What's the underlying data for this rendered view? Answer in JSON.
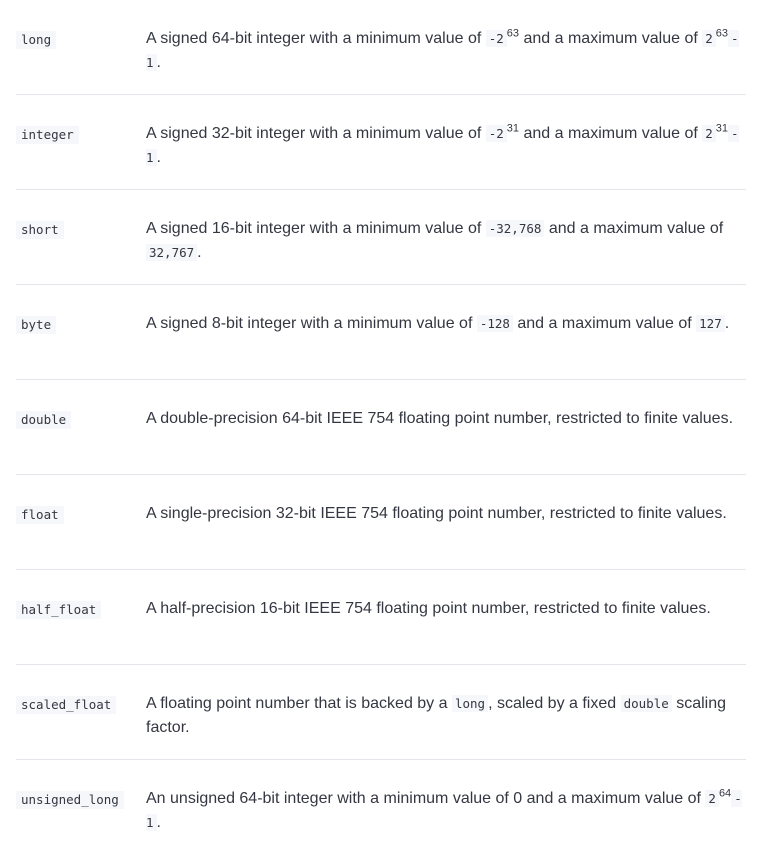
{
  "rows": [
    {
      "type": "long",
      "desc": [
        {
          "t": "A signed 64-bit integer with a minimum value of "
        },
        {
          "code": "-2"
        },
        {
          "sup": "63"
        },
        {
          "t": " and a maximum value of "
        },
        {
          "code": "2"
        },
        {
          "sup": "63"
        },
        {
          "code": "-1"
        },
        {
          "t": "."
        }
      ]
    },
    {
      "type": "integer",
      "desc": [
        {
          "t": "A signed 32-bit integer with a minimum value of "
        },
        {
          "code": "-2"
        },
        {
          "sup": "31"
        },
        {
          "t": " and a maximum value of "
        },
        {
          "code": "2"
        },
        {
          "sup": "31"
        },
        {
          "code": "-1"
        },
        {
          "t": "."
        }
      ]
    },
    {
      "type": "short",
      "desc": [
        {
          "t": "A signed 16-bit integer with a minimum value of "
        },
        {
          "code": "-32,768"
        },
        {
          "t": " and a maximum value of "
        },
        {
          "code": "32,767"
        },
        {
          "t": "."
        }
      ]
    },
    {
      "type": "byte",
      "desc": [
        {
          "t": "A signed 8-bit integer with a minimum value of "
        },
        {
          "code": "-128"
        },
        {
          "t": " and a maximum value of "
        },
        {
          "code": "127"
        },
        {
          "t": "."
        }
      ]
    },
    {
      "type": "double",
      "desc": [
        {
          "t": "A double-precision 64-bit IEEE 754 floating point number, restricted to finite values."
        }
      ]
    },
    {
      "type": "float",
      "desc": [
        {
          "t": "A single-precision 32-bit IEEE 754 floating point number, restricted to finite values."
        }
      ]
    },
    {
      "type": "half_float",
      "desc": [
        {
          "t": "A half-precision 16-bit IEEE 754 floating point number, restricted to finite values."
        }
      ]
    },
    {
      "type": "scaled_float",
      "desc": [
        {
          "t": "A floating point number that is backed by a "
        },
        {
          "code": "long"
        },
        {
          "t": ", scaled by a fixed "
        },
        {
          "code": "double"
        },
        {
          "t": " scaling factor."
        }
      ]
    },
    {
      "type": "unsigned_long",
      "desc": [
        {
          "t": "An unsigned 64-bit integer with a minimum value of 0 and a maximum value of "
        },
        {
          "code": "2"
        },
        {
          "sup": "64"
        },
        {
          "code": "-1"
        },
        {
          "t": "."
        }
      ]
    }
  ]
}
